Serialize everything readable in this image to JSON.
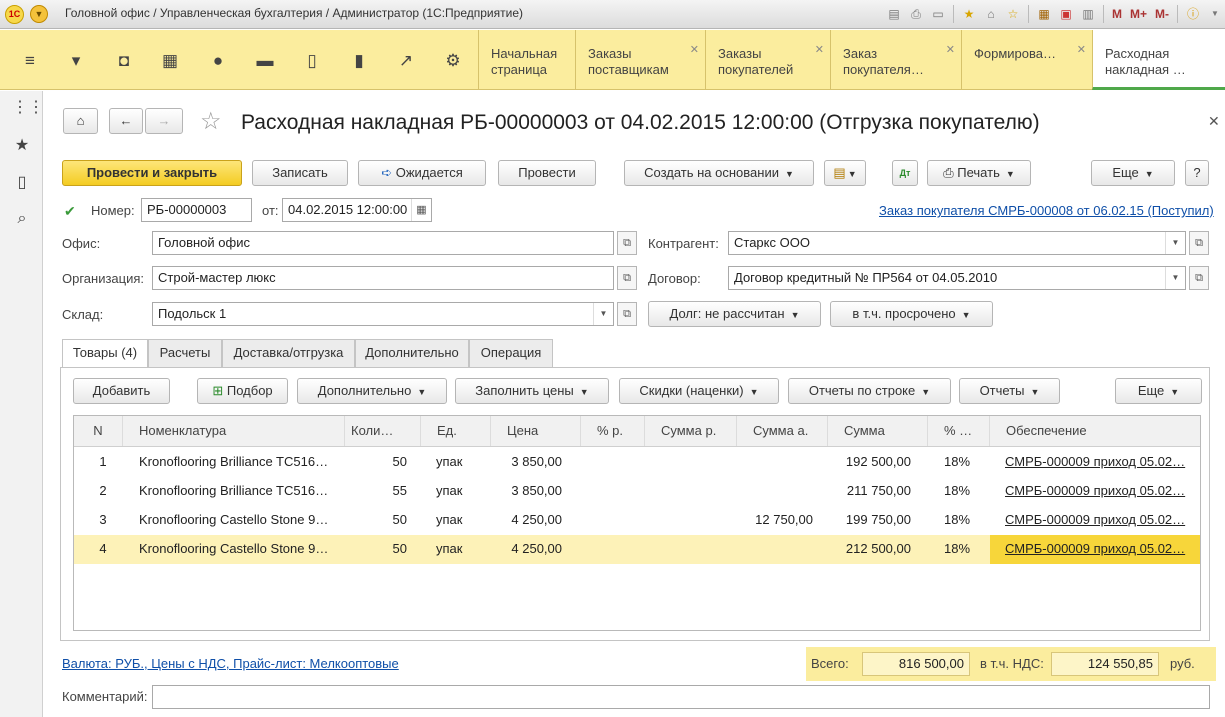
{
  "window": {
    "title": "Головной офис / Управленческая бухгалтерия / Администратор  (1С:Предприятие)",
    "logo_text": "1С",
    "toolbar_labels": [
      "M",
      "M+",
      "M-"
    ]
  },
  "sections": {
    "tabs": [
      {
        "label": "Начальная страница",
        "closable": false
      },
      {
        "label": "Заказы поставщикам",
        "closable": true
      },
      {
        "label": "Заказы покупателей",
        "closable": true
      },
      {
        "label": "Заказ покупателя…",
        "closable": true
      },
      {
        "label": "Формирова…",
        "closable": true
      },
      {
        "label": "Расходная накладная …",
        "closable": false
      }
    ]
  },
  "form": {
    "title": "Расходная накладная РБ-00000003 от 04.02.2015 12:00:00 (Отгрузка покупателю)",
    "buttons": {
      "post_close": "Провести и закрыть",
      "save": "Записать",
      "expected": "Ожидается",
      "post": "Провести",
      "create_based": "Создать на основании",
      "print": "Печать",
      "more": "Еще",
      "help": "?"
    },
    "number_label": "Номер:",
    "number_value": "РБ-00000003",
    "date_label": "от:",
    "date_value": "04.02.2015 12:00:00",
    "order_link": "Заказ покупателя СМРБ-000008 от 06.02.15 (Поступил)",
    "office_label": "Офис:",
    "office_value": "Головной офис",
    "org_label": "Организация:",
    "org_value": "Строй-мастер люкс",
    "warehouse_label": "Склад:",
    "warehouse_value": "Подольск 1",
    "counterparty_label": "Контрагент:",
    "counterparty_value": "Старкс ООО",
    "contract_label": "Договор:",
    "contract_value": "Договор кредитный № ПР564 от 04.05.2010",
    "debt_button": "Долг: не рассчитан",
    "overdue_button": "в т.ч. просрочено"
  },
  "tabs": [
    {
      "label": "Товары (4)"
    },
    {
      "label": "Расчеты"
    },
    {
      "label": "Доставка/отгрузка"
    },
    {
      "label": "Дополнительно"
    },
    {
      "label": "Операция"
    }
  ],
  "table_toolbar": {
    "add": "Добавить",
    "pick": "Подбор",
    "additional": "Дополнительно",
    "fill_prices": "Заполнить цены",
    "discounts": "Скидки (наценки)",
    "row_reports": "Отчеты по строке",
    "reports": "Отчеты",
    "more": "Еще"
  },
  "table": {
    "headers": [
      "N",
      "Номенклатура",
      "Коли…",
      "Ед.",
      "Цена",
      "% р.",
      "Сумма р.",
      "Сумма а.",
      "Сумма",
      "% …",
      "Обеспечение"
    ],
    "rows": [
      [
        "1",
        "Kronoflooring Brilliance TC516…",
        "50",
        "упак",
        "3 850,00",
        "",
        "",
        "",
        "192 500,00",
        "18%",
        "СМРБ-000009 приход 05.02…"
      ],
      [
        "2",
        "Kronoflooring Brilliance TC516…",
        "55",
        "упак",
        "3 850,00",
        "",
        "",
        "",
        "211 750,00",
        "18%",
        "СМРБ-000009 приход 05.02…"
      ],
      [
        "3",
        "Kronoflooring Castello Stone 9…",
        "50",
        "упак",
        "4 250,00",
        "",
        "",
        "12 750,00",
        "199 750,00",
        "18%",
        "СМРБ-000009 приход 05.02…"
      ],
      [
        "4",
        "Kronoflooring Castello Stone 9…",
        "50",
        "упак",
        "4 250,00",
        "",
        "",
        "",
        "212 500,00",
        "18%",
        "СМРБ-000009 приход 05.02…"
      ]
    ],
    "selected_row": 4
  },
  "footer": {
    "currency_link": "Валюта: РУБ., Цены с НДС, Прайс-лист: Мелкооптовые",
    "total_label": "Всего:",
    "total_value": "816 500,00",
    "vat_label": "в т.ч. НДС:",
    "vat_value": "124 550,85",
    "currency": "руб.",
    "comment_label": "Комментарий:",
    "comment_value": ""
  },
  "colors": {
    "accent": "#f4cc22",
    "section_bar": "#fbed9e",
    "link": "#0f4fa8",
    "active_tab_underline": "#4fa84a"
  }
}
